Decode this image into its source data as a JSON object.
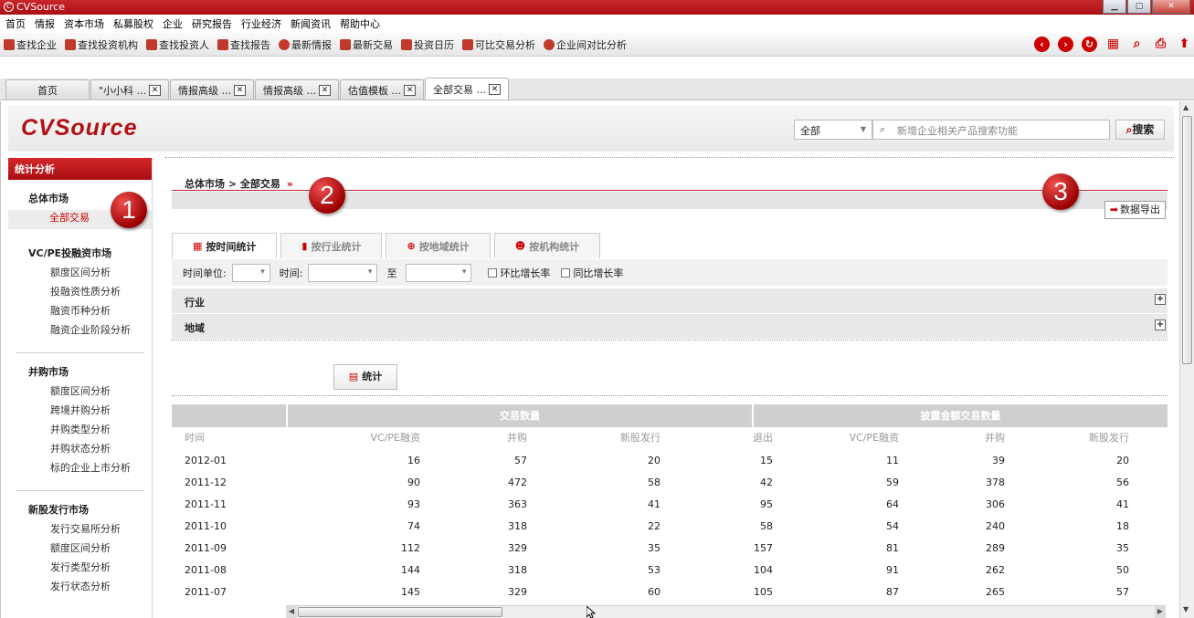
{
  "window": {
    "title": "CVSource",
    "buttons": [
      "minimize",
      "maximize",
      "close"
    ]
  },
  "menu": [
    "首页",
    "情报",
    "资本市场",
    "私募股权",
    "企业",
    "研究报告",
    "行业经济",
    "新闻资讯",
    "帮助中心"
  ],
  "toolbar": {
    "items": [
      {
        "label": "查找企业",
        "icon": "find-company-icon",
        "color": "#c0392b"
      },
      {
        "label": "查找投资机构",
        "icon": "find-investor-org-icon",
        "color": "#c0392b"
      },
      {
        "label": "查找投资人",
        "icon": "find-investor-icon",
        "color": "#c0392b"
      },
      {
        "label": "查找报告",
        "icon": "report-list-icon",
        "color": "#c0392b"
      },
      {
        "label": "最新情报",
        "icon": "news-bubble-icon",
        "color": "#c0392b"
      },
      {
        "label": "最新交易",
        "icon": "chart-icon",
        "color": "#c0392b"
      },
      {
        "label": "投资日历",
        "icon": "calendar-icon",
        "color": "#c0392b"
      },
      {
        "label": "可比交易分析",
        "icon": "bar-chart-icon",
        "color": "#c0392b"
      },
      {
        "label": "企业间对比分析",
        "icon": "pie-chart-icon",
        "color": "#c0392b"
      }
    ],
    "right_icons": [
      "back-icon",
      "forward-icon",
      "refresh-icon",
      "calculator-icon",
      "search-icon",
      "print-icon",
      "up-icon"
    ]
  },
  "tabs": [
    {
      "label": "首页",
      "closable": false,
      "active": false
    },
    {
      "label": "\"小小科 ...",
      "closable": true,
      "active": false
    },
    {
      "label": "情报高级 ...",
      "closable": true,
      "active": false
    },
    {
      "label": "情报高级 ...",
      "closable": true,
      "active": false
    },
    {
      "label": "估值模板 ...",
      "closable": true,
      "active": false
    },
    {
      "label": "全部交易 ...",
      "closable": true,
      "active": true
    }
  ],
  "header": {
    "brand": "CVSource",
    "scope_select": "全部",
    "search_placeholder": "新增企业相关产品搜索功能",
    "search_button": "搜索"
  },
  "sidebar": {
    "heading": "统计分析",
    "groups": [
      {
        "title": "总体市场",
        "items": [
          {
            "label": "全部交易",
            "active": true
          }
        ]
      },
      {
        "title": "VC/PE投融资市场",
        "items": [
          {
            "label": "额度区间分析"
          },
          {
            "label": "投融资性质分析"
          },
          {
            "label": "融资币种分析"
          },
          {
            "label": "融资企业阶段分析"
          }
        ]
      },
      {
        "title": "并购市场",
        "items": [
          {
            "label": "额度区间分析"
          },
          {
            "label": "跨境并购分析"
          },
          {
            "label": "并购类型分析"
          },
          {
            "label": "并购状态分析"
          },
          {
            "label": "标的企业上市分析"
          }
        ]
      },
      {
        "title": "新股发行市场",
        "items": [
          {
            "label": "发行交易所分析"
          },
          {
            "label": "额度区间分析"
          },
          {
            "label": "发行类型分析"
          },
          {
            "label": "发行状态分析"
          }
        ]
      }
    ]
  },
  "breadcrumb": {
    "root": "总体市场",
    "sep": ">",
    "current": "全部交易",
    "more": "»"
  },
  "export_button": "数据导出",
  "annotations": [
    "1",
    "2",
    "3"
  ],
  "stat_tabs": [
    {
      "label": "按时间统计",
      "icon": "calendar-icon",
      "active": true
    },
    {
      "label": "按行业统计",
      "icon": "bar-chart-icon",
      "active": false
    },
    {
      "label": "按地域统计",
      "icon": "globe-icon",
      "active": false
    },
    {
      "label": "按机构统计",
      "icon": "people-icon",
      "active": false
    }
  ],
  "filters": {
    "unit_label": "时间单位:",
    "time_label": "时间:",
    "to_label": "至",
    "mom_label": "环比增长率",
    "yoy_label": "同比增长率",
    "industry_label": "行业",
    "region_label": "地域"
  },
  "stat_button": "统计",
  "table": {
    "group_headers": [
      "交易数量",
      "披露金额交易数量"
    ],
    "columns": [
      "时间",
      "VC/PE融资",
      "并购",
      "新股发行",
      "退出",
      "VC/PE融资",
      "并购",
      "新股发行"
    ],
    "rows": [
      [
        "2012-01",
        "16",
        "57",
        "20",
        "15",
        "11",
        "39",
        "20"
      ],
      [
        "2011-12",
        "90",
        "472",
        "58",
        "42",
        "59",
        "378",
        "56"
      ],
      [
        "2011-11",
        "93",
        "363",
        "41",
        "95",
        "64",
        "306",
        "41"
      ],
      [
        "2011-10",
        "74",
        "318",
        "22",
        "58",
        "54",
        "240",
        "18"
      ],
      [
        "2011-09",
        "112",
        "329",
        "35",
        "157",
        "81",
        "289",
        "35"
      ],
      [
        "2011-08",
        "144",
        "318",
        "53",
        "104",
        "91",
        "262",
        "50"
      ],
      [
        "2011-07",
        "145",
        "329",
        "60",
        "105",
        "87",
        "265",
        "57"
      ]
    ]
  },
  "colors": {
    "brand_red": "#b21014",
    "active_link": "#cc0000",
    "header_gray": "#cfcfcf"
  }
}
